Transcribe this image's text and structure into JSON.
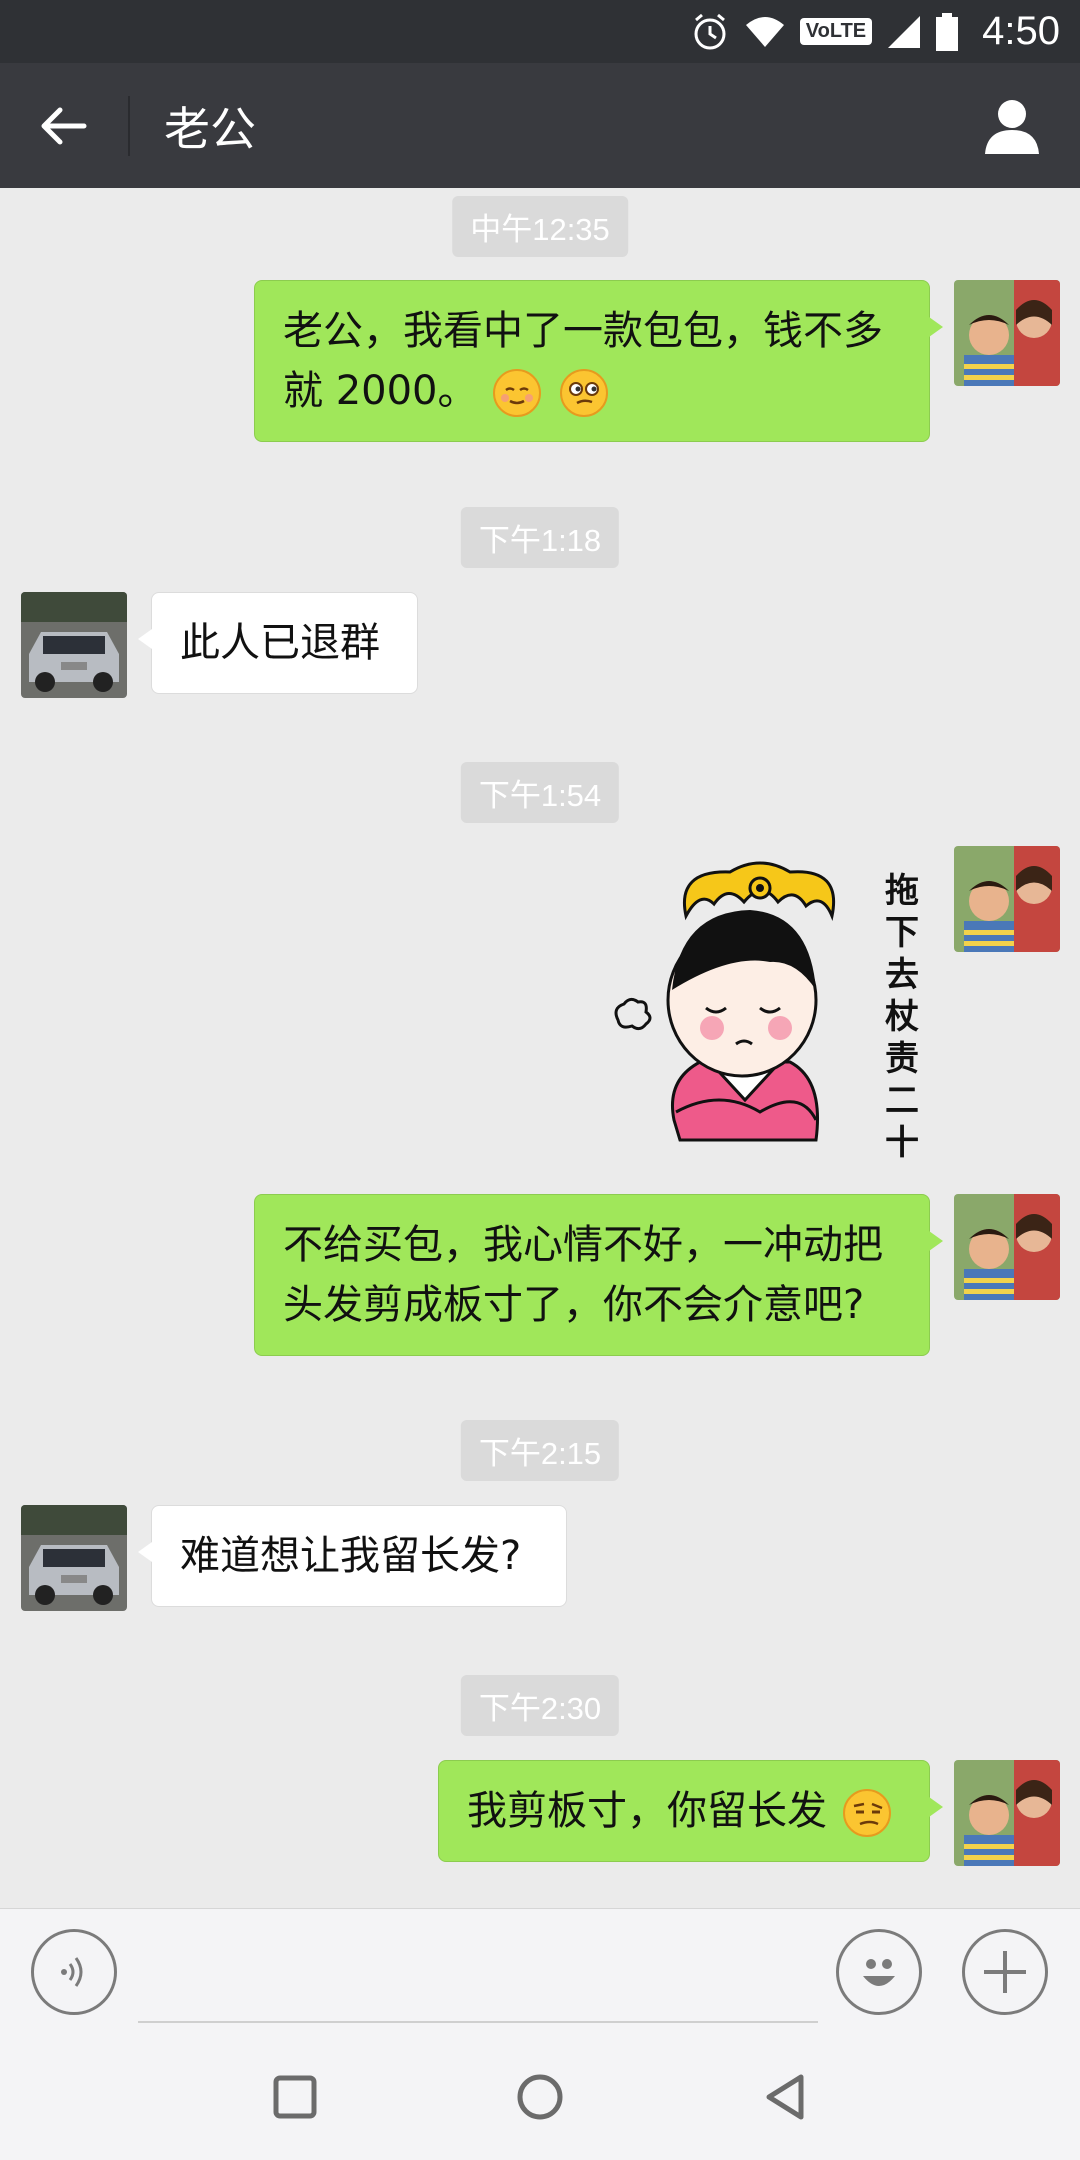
{
  "status_bar": {
    "time": "4:50",
    "volte_label": "VoLTE",
    "icons": [
      "alarm-icon",
      "wifi-icon",
      "volte-icon",
      "signal-icon",
      "battery-icon"
    ]
  },
  "header": {
    "title": "老公",
    "back_icon": "back-arrow-icon",
    "profile_icon": "person-icon"
  },
  "messages": [
    {
      "type": "time",
      "text": "中午12:35"
    },
    {
      "type": "text",
      "from": "me",
      "text": "老公，我看中了一款包包，钱不多就 2000。",
      "emojis": [
        "blush-emoji",
        "smirk-emoji"
      ]
    },
    {
      "type": "time",
      "text": "下午1:18"
    },
    {
      "type": "text",
      "from": "them",
      "text": "此人已退群"
    },
    {
      "type": "time",
      "text": "下午1:54"
    },
    {
      "type": "sticker",
      "from": "me",
      "caption": "拖下去杖责二十",
      "sticker_name": "empress-sticker"
    },
    {
      "type": "text",
      "from": "me",
      "text": "不给买包，我心情不好，一冲动把头发剪成板寸了，你不会介意吧?"
    },
    {
      "type": "time",
      "text": "下午2:15"
    },
    {
      "type": "text",
      "from": "them",
      "text": "难道想让我留长发?"
    },
    {
      "type": "time",
      "text": "下午2:30"
    },
    {
      "type": "text",
      "from": "me",
      "text": "我剪板寸，你留长发",
      "emojis": [
        "skeptical-emoji"
      ]
    }
  ],
  "input_bar": {
    "placeholder": "",
    "voice_icon": "voice-icon",
    "emoji_icon": "emoji-icon",
    "plus_icon": "plus-icon"
  },
  "nav_bar": {
    "buttons": [
      "recent-apps-icon",
      "home-icon",
      "back-icon"
    ]
  },
  "colors": {
    "header_bg": "#393a3f",
    "status_bg": "#2f3135",
    "my_bubble": "#a0e75a",
    "their_bubble": "#ffffff",
    "chat_bg": "#ebebeb"
  }
}
